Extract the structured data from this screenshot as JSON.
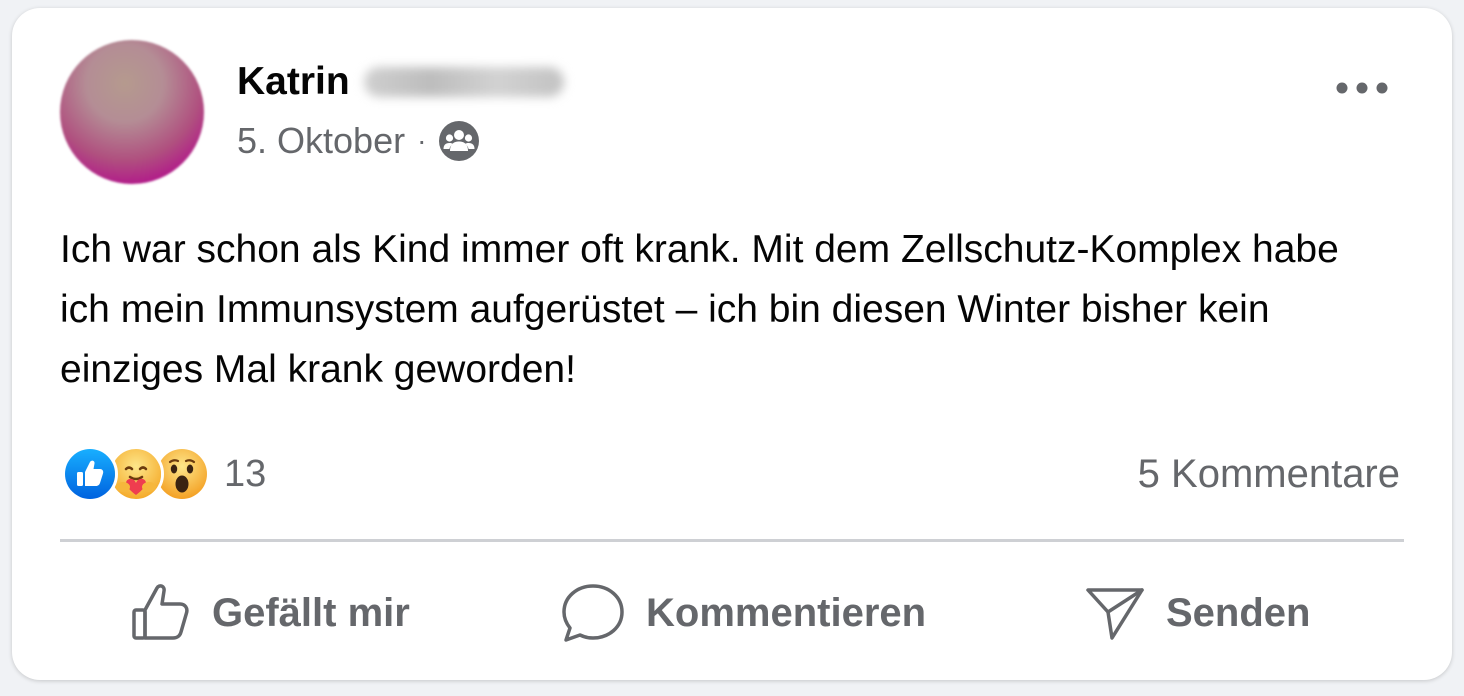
{
  "post": {
    "author_first_name": "Katrin",
    "date": "5. Oktober",
    "separator": "·",
    "audience_icon": "group-icon",
    "text": "Ich war schon als Kind immer oft krank. Mit dem Zellschutz-Komplex habe ich mein Immunsystem aufgerüstet – ich bin diesen Winter bisher kein einziges Mal krank geworden!",
    "more_icon": "more-options-icon"
  },
  "reactions": {
    "icons": [
      "like-reaction-icon",
      "care-reaction-icon",
      "wow-reaction-icon"
    ],
    "count": "13"
  },
  "comments": {
    "count_label": "5 Kommentare"
  },
  "actions": {
    "like_label": "Gefällt mir",
    "comment_label": "Kommentieren",
    "send_label": "Senden"
  },
  "colors": {
    "like_blue": "#1877f2",
    "secondary_text": "#65676b",
    "primary_text": "#050505",
    "divider": "#ced0d4"
  }
}
